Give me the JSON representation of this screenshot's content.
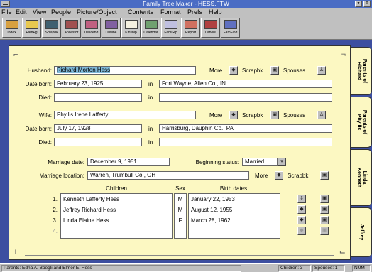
{
  "window": {
    "title": "Family Tree Maker - HESS.FTW",
    "minimize_glyph": "▾",
    "restore_glyph": "⇕"
  },
  "menu": [
    "File",
    "Edit",
    "View",
    "People",
    "Picture/Object",
    "Contents",
    "Format",
    "Prefs",
    "Help"
  ],
  "toolbar": [
    {
      "label": "Index",
      "icon": "index-icon",
      "color": "#d8a040"
    },
    {
      "label": "FamPg",
      "icon": "family-page-icon",
      "color": "#e8c850"
    },
    {
      "label": "Scrapbk",
      "icon": "scrapbook-icon",
      "color": "#406070"
    },
    {
      "label": "Ancestor",
      "icon": "ancestor-tree-icon",
      "color": "#a05050"
    },
    {
      "label": "Descend",
      "icon": "descendant-tree-icon",
      "color": "#c06080"
    },
    {
      "label": "Outline",
      "icon": "outline-icon",
      "color": "#8060a0"
    },
    {
      "label": "Kinship",
      "icon": "kinship-icon",
      "color": "#f4f0e0"
    },
    {
      "label": "Calendar",
      "icon": "calendar-icon",
      "color": "#70a070"
    },
    {
      "label": "FamGrp",
      "icon": "family-group-icon",
      "color": "#c0c0e0"
    },
    {
      "label": "Report",
      "icon": "report-icon",
      "color": "#d07060"
    },
    {
      "label": "Labels",
      "icon": "labels-icon",
      "color": "#b04040"
    },
    {
      "label": "FamFind",
      "icon": "famfind-icon",
      "color": "#6070c0"
    }
  ],
  "husband": {
    "label": "Husband:",
    "name": "Richard Morton Hess",
    "date_born_label": "Date born:",
    "date_born": "February 23, 1925",
    "in_label": "in",
    "born_place": "Fort Wayne, Allen Co., IN",
    "died_label": "Died:",
    "died_date": "",
    "died_place": ""
  },
  "wife": {
    "label": "Wife:",
    "name": "Phyllis Irene Lafferty",
    "date_born_label": "Date born:",
    "date_born": "July 17, 1928",
    "in_label": "in",
    "born_place": "Harrisburg, Dauphin Co., PA",
    "died_label": "Died:",
    "died_date": "",
    "died_place": ""
  },
  "buttons": {
    "more": "More",
    "scrapbk": "Scrapbk",
    "spouses": "Spouses"
  },
  "marriage": {
    "date_label": "Marriage date:",
    "date": "December 9, 1951",
    "status_label": "Beginning status:",
    "status": "Married",
    "location_label": "Marriage location:",
    "location": "Warren, Trumbull Co., OH"
  },
  "children": {
    "headers": {
      "children": "Children",
      "sex": "Sex",
      "birth": "Birth dates"
    },
    "rows": [
      {
        "num": "1.",
        "name": "Kenneth Lafferty Hess",
        "sex": "M",
        "birth": "January 22, 1953"
      },
      {
        "num": "2.",
        "name": "Jeffrey Richard Hess",
        "sex": "M",
        "birth": "August 12, 1955"
      },
      {
        "num": "3.",
        "name": "Linda Elaine Hess",
        "sex": "F",
        "birth": "March 28, 1962"
      },
      {
        "num": "4.",
        "name": "",
        "sex": "",
        "birth": ""
      }
    ]
  },
  "tabs": [
    {
      "text": "Parents of\nRichard"
    },
    {
      "text": "Parents of\nPhyllis"
    },
    {
      "text": "Linda\nKenneth"
    },
    {
      "text": "Jeffrey"
    }
  ],
  "status": {
    "parents": "Parents: Edna A. Boegli and Elmer E. Hess",
    "children": "Children: 3",
    "spouses": "Spouses: 1",
    "num": "NUM"
  },
  "colors": {
    "title_bar": "#4a6cc4",
    "workspace": "#3d4fa0",
    "card": "#fcf8c2",
    "selection": "#7fb8d8"
  }
}
